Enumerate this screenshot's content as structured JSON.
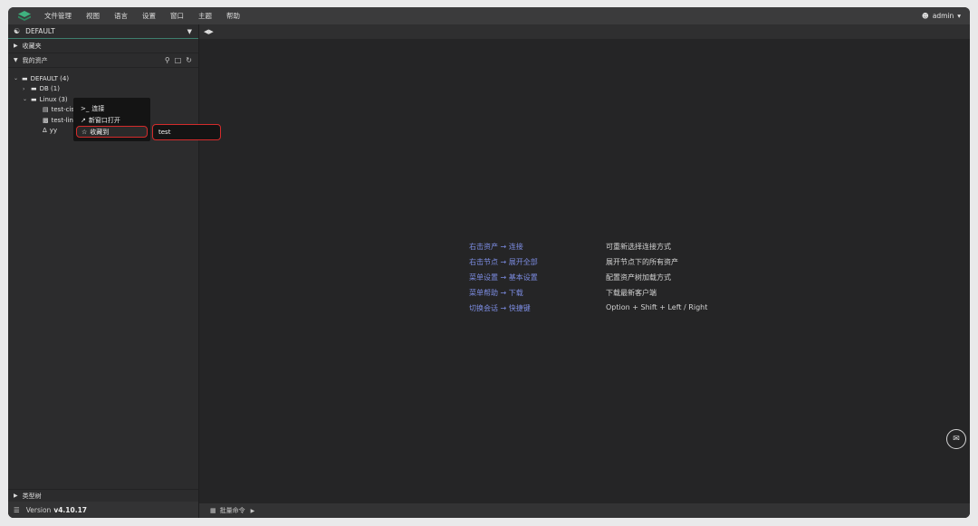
{
  "menubar": {
    "items": [
      "文件管理",
      "视图",
      "语言",
      "设置",
      "窗口",
      "主题",
      "帮助"
    ],
    "user": "admin"
  },
  "sidebar": {
    "env_label": "DEFAULT",
    "favorites_label": "收藏夹",
    "my_assets_label": "我的资产",
    "tree": {
      "root": "DEFAULT (4)",
      "db": "DB (1)",
      "linux": "Linux (3)",
      "item1": "test-cis",
      "item2": "test-lin",
      "item3": "yy"
    },
    "type_tree_label": "类型树",
    "version_prefix": "Version",
    "version": "v4.10.17"
  },
  "context_menu": {
    "connect": "连接",
    "open_new_window": "新窗口打开",
    "favorite_to": "收藏到",
    "submenu_item": "test"
  },
  "main": {
    "help": [
      {
        "k": "右击资产 → 连接",
        "v": "可重新选择连接方式"
      },
      {
        "k": "右击节点 → 展开全部",
        "v": "展开节点下的所有资产"
      },
      {
        "k": "菜单设置 → 基本设置",
        "v": "配置资产树加载方式"
      },
      {
        "k": "菜单帮助 → 下载",
        "v": "下载最新客户端"
      },
      {
        "k": "切换会话 → 快捷键",
        "v": "Option + Shift + Left / Right"
      }
    ],
    "statusbar_label": "批量命令"
  },
  "colors": {
    "accent_link": "#7b8be0",
    "highlight_border": "#d42b2b",
    "logo": "#3fb27f"
  }
}
